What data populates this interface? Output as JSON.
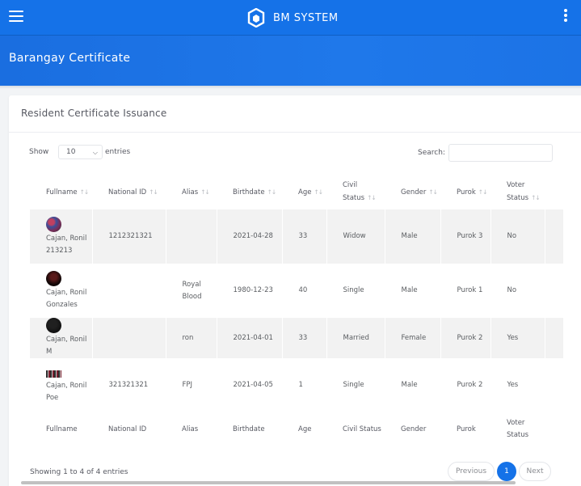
{
  "topbar": {
    "brand": "BM SYSTEM",
    "menu_icon": "hamburger-icon",
    "logo_icon": "shield-logo-icon",
    "more_icon": "vertical-dots-icon",
    "color": "#1572e8"
  },
  "page": {
    "title": "Barangay Certificate"
  },
  "card": {
    "title": "Resident Certificate Issuance",
    "show_label": "Show",
    "entries_value": "10",
    "entries_label": "entries",
    "search_label": "Search:",
    "search_placeholder": ""
  },
  "table": {
    "columns": [
      {
        "label": "Fullname",
        "sort": "↑↓"
      },
      {
        "label": "National ID",
        "sort": "↑↓"
      },
      {
        "label": "Alias",
        "sort": "↑↓"
      },
      {
        "label": "Birthdate",
        "sort": "↑↓"
      },
      {
        "label": "Age",
        "sort": "↑↓"
      },
      {
        "label": "Civil Status",
        "sort": "↑↓"
      },
      {
        "label": "Gender",
        "sort": "↑↓"
      },
      {
        "label": "Purok",
        "sort": "↑↓"
      },
      {
        "label": "Voter Status",
        "sort": "↑↓"
      }
    ],
    "rows": [
      {
        "fullname": "Cajan, Ronil 213213",
        "national_id": "1212321321",
        "alias": "",
        "birthdate": "2021-04-28",
        "age": "33",
        "civil_status": "Widow",
        "gender": "Male",
        "purok": "Purok 3",
        "voter_status": "No"
      },
      {
        "fullname": "Cajan, Ronil Gonzales",
        "national_id": "",
        "alias": "Royal Blood",
        "birthdate": "1980-12-23",
        "age": "40",
        "civil_status": "Single",
        "gender": "Male",
        "purok": "Purok 1",
        "voter_status": "No"
      },
      {
        "fullname": "Cajan, Ronil M",
        "national_id": "",
        "alias": "ron",
        "birthdate": "2021-04-01",
        "age": "33",
        "civil_status": "Married",
        "gender": "Female",
        "purok": "Purok 2",
        "voter_status": "Yes"
      },
      {
        "fullname": "Cajan, Ronil Poe",
        "national_id": "321321321",
        "alias": "FPJ",
        "birthdate": "2021-04-05",
        "age": "1",
        "civil_status": "Single",
        "gender": "Male",
        "purok": "Purok 2",
        "voter_status": "Yes"
      }
    ]
  },
  "footer": {
    "info": "Showing 1 to 4 of 4 entries",
    "previous": "Previous",
    "page": "1",
    "next": "Next"
  }
}
